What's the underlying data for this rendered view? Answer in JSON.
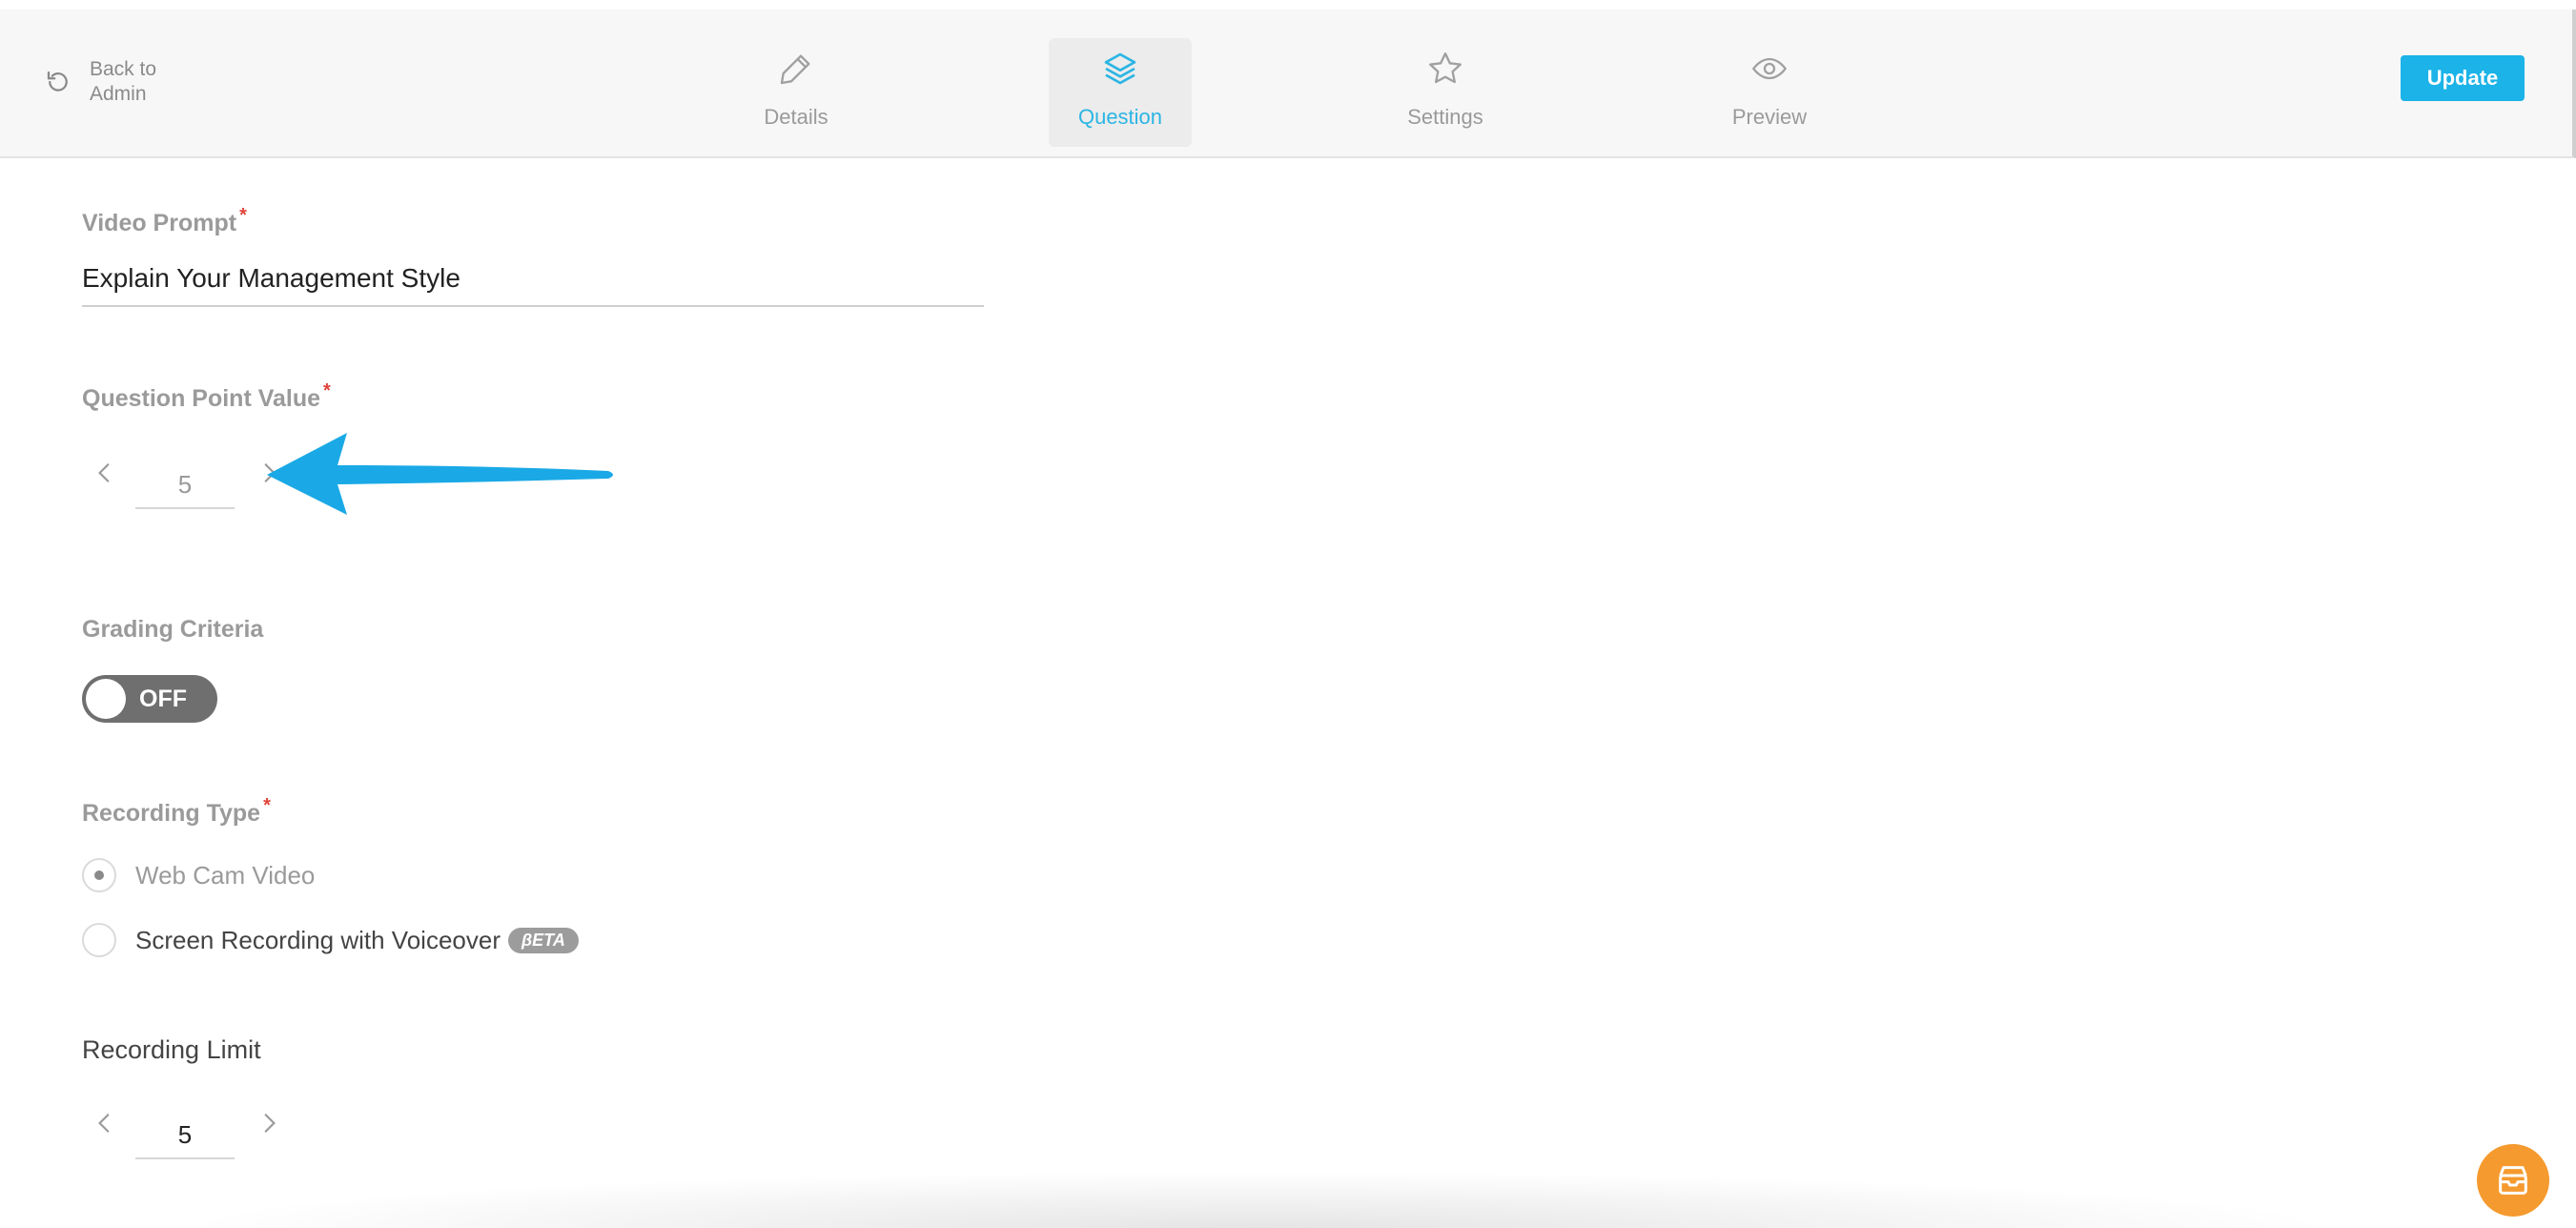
{
  "header": {
    "back_label": "Back to Admin",
    "nav": [
      {
        "label": "Details",
        "icon": "pencil-icon"
      },
      {
        "label": "Question",
        "icon": "layers-icon"
      },
      {
        "label": "Settings",
        "icon": "star-icon"
      },
      {
        "label": "Preview",
        "icon": "eye-icon"
      }
    ],
    "active_tab": "Question",
    "update_label": "Update"
  },
  "form": {
    "video_prompt": {
      "label": "Video Prompt",
      "required_mark": "*",
      "value": "Explain Your Management Style"
    },
    "point_value": {
      "label": "Question Point Value",
      "required_mark": "*",
      "value": "5"
    },
    "grading": {
      "label": "Grading Criteria",
      "toggle": "OFF"
    },
    "recording_type": {
      "label": "Recording Type",
      "required_mark": "*",
      "options": [
        {
          "label": "Web Cam Video",
          "checked": true
        },
        {
          "label": "Screen Recording with Voiceover",
          "checked": false,
          "badge": "βETA"
        }
      ]
    },
    "recording_limit": {
      "label": "Recording Limit",
      "value": "5"
    }
  },
  "colors": {
    "accent": "#1bb3e8",
    "required": "#e0443a",
    "arrow": "#1aa9e6",
    "chat": "#f59a2e"
  },
  "icons": {
    "back": "refresh-icon",
    "chat": "chat-icon",
    "annotation": "annotation-arrow-icon"
  }
}
